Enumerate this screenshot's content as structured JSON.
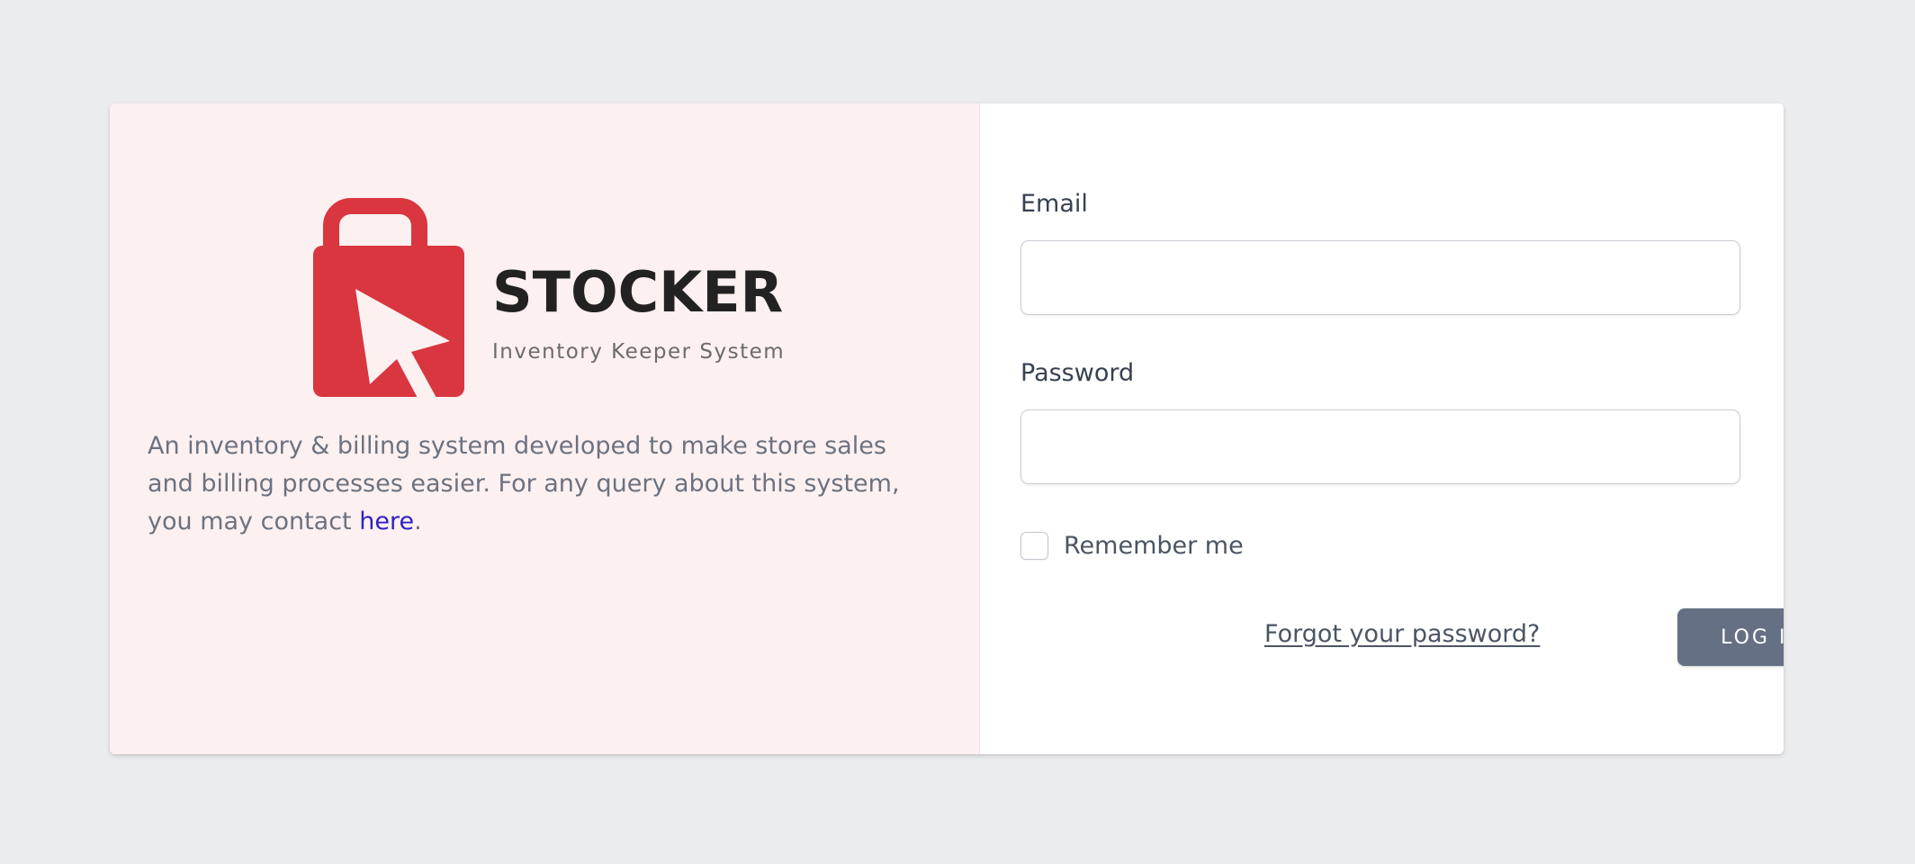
{
  "brand": {
    "name": "STOCKER",
    "tagline": "Inventory Keeper System",
    "logo_color": "#d93640"
  },
  "description": {
    "text": "An inventory & billing system developed to make store sales and billing processes easier. For any query about this system, you may contact ",
    "link_text": "here",
    "suffix": "."
  },
  "form": {
    "email_label": "Email",
    "email_value": "",
    "password_label": "Password",
    "password_value": "",
    "remember_label": "Remember me",
    "remember_checked": false,
    "forgot_link": "Forgot your password?",
    "login_button": "LOG IN"
  },
  "colors": {
    "left_panel_bg": "#fdf0f0",
    "button_bg": "#667085",
    "link": "#2f22c6"
  }
}
